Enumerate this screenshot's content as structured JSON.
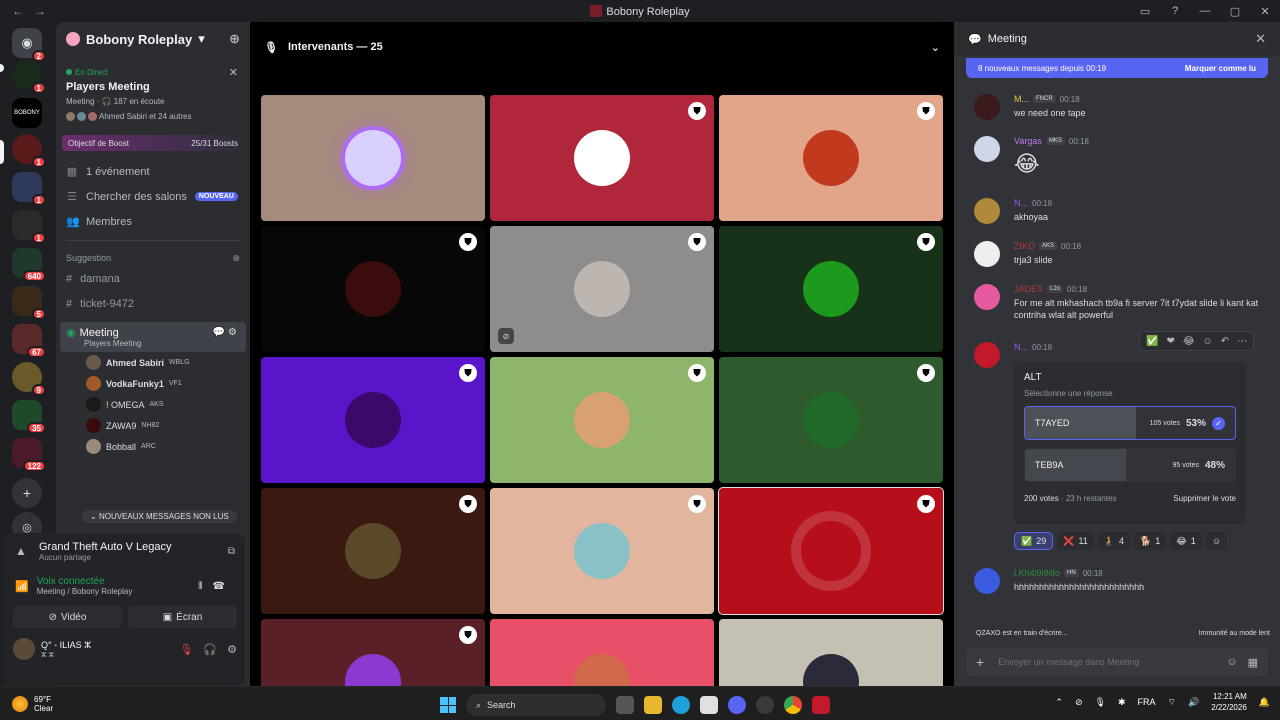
{
  "window": {
    "title": "Bobony Roleplay"
  },
  "rail": {
    "badges": [
      "2",
      "1",
      "1",
      "1",
      "1",
      "640",
      "5",
      "67",
      "9",
      "35",
      "122"
    ]
  },
  "server": {
    "name": "Bobony Roleplay"
  },
  "event": {
    "live_label": "En Direct",
    "title": "Players Meeting",
    "meta_channel": "Meeting",
    "meta_listeners": "187 en écoute",
    "people": "Ahmed Sabiri et 24 autres"
  },
  "boost": {
    "label": "Objectif de Boost",
    "progress": "25/31 Boosts"
  },
  "nav": {
    "events": "1 événement",
    "browse": "Chercher des salons",
    "browse_badge": "NOUVEAU",
    "members": "Membres"
  },
  "category": {
    "name": "Suggestion"
  },
  "channels": [
    "damana",
    "ticket-9472"
  ],
  "voice_channel": {
    "name": "Meeting",
    "sub": "Players Meeting"
  },
  "voice_users": [
    {
      "name": "Ahmed Sabiri",
      "tag": "WBLG"
    },
    {
      "name": "VodkaFunky1",
      "tag": "VF1"
    },
    {
      "name": "! OMEGA",
      "tag": "AKS"
    },
    {
      "name": "ZAWA9",
      "tag": "NH82"
    },
    {
      "name": "Bobball",
      "tag": "ARC"
    }
  ],
  "new_messages_pill": "NOUVEAUX MESSAGES NON LUS",
  "activity": {
    "game": "Grand Theft Auto V Legacy",
    "status": "Aucun partage"
  },
  "voice_status": {
    "title": "Voix connectée",
    "sub": "Meeting / Bobony Roleplay"
  },
  "buttons": {
    "video": "Vidéo",
    "screen": "Écran"
  },
  "user": {
    "name": "Q° - ILIAS ⵣ",
    "status": "ⵣ ⵣ"
  },
  "stage": {
    "header": "Intervenants — 25"
  },
  "chat": {
    "title": "Meeting",
    "unread_text": "8 nouveaux messages depuis 00:19",
    "mark_read": "Marquer comme lu",
    "messages": [
      {
        "name": "M...",
        "tag": "FNCR",
        "time": "00:18",
        "text": "we need one tape",
        "color": "#e8c547"
      },
      {
        "name": "Vargas",
        "tag": "MKS",
        "time": "00:18",
        "text": "😂",
        "color": "#c27cf2"
      },
      {
        "name": "N...",
        "tag": "",
        "time": "00:18",
        "text": "akhoyaa",
        "color": "#8d5ae0"
      },
      {
        "name": "ZIKO",
        "tag": "AKS",
        "time": "00:18",
        "text": "trja3 slide",
        "color": "#b83a3a"
      },
      {
        "name": "JADEX",
        "tag": "L2o",
        "time": "00:18",
        "text": "For me alt mkhashach tb9a fi server 7it t7ydat slide li kant kat contriha wlat alt powerful",
        "color": "#b83a3a"
      },
      {
        "name": "N...",
        "tag": "",
        "time": "00:18",
        "text": "",
        "color": "#8d5ae0"
      },
      {
        "name": "l.Kh4i9i9ilfo",
        "tag": "HN",
        "time": "00:18",
        "text": "hhhhhhhhhhhhhhhhhhhhhhhhhh",
        "color": "#2e8b3a"
      }
    ],
    "poll": {
      "question": "ALT",
      "select_hint": "Sélectionne une réponse",
      "options": [
        {
          "label": "T7AYED",
          "votes": "105 votes",
          "pct": "53%",
          "fraction": 0.53,
          "chosen": true
        },
        {
          "label": "TEB9A",
          "votes": "95 votes",
          "pct": "48%",
          "fraction": 0.48,
          "chosen": false
        }
      ],
      "total": "200 votes",
      "remaining": "23 h restantes",
      "remove": "Supprimer le vote"
    },
    "reactions": [
      {
        "emoji": "✅",
        "count": "29",
        "me": true
      },
      {
        "emoji": "❌",
        "count": "11",
        "me": false
      },
      {
        "emoji": "🧎",
        "count": "4",
        "me": false
      },
      {
        "emoji": "🐕",
        "count": "1",
        "me": false
      },
      {
        "emoji": "😂",
        "count": "1",
        "me": false
      }
    ],
    "typing": "QZAXO est en train d'écrire...",
    "slowmode": "Immunité au mode lent",
    "placeholder": "Envoyer un message dans Meeting"
  },
  "taskbar": {
    "temp": "69°F",
    "condition": "Clear",
    "search": "Search",
    "lang": "FRA",
    "time": "12:21 AM",
    "date": "2/22/2026"
  },
  "tiles": [
    {
      "bg": "#a58a7e",
      "av": "#d9d0ff",
      "mod": false
    },
    {
      "bg": "#b0263a",
      "av": "#ffffff",
      "mod": true
    },
    {
      "bg": "#e2a58a",
      "av": "#c23a1e",
      "mod": true
    },
    {
      "bg": "#070707",
      "av": "#3a0d0d",
      "mod": true
    },
    {
      "bg": "#8f8c8c",
      "av": "#bcb5b0",
      "mod": true,
      "hidden": true
    },
    {
      "bg": "#173218",
      "av": "#1c9a1e",
      "mod": true
    },
    {
      "bg": "#5a14c9",
      "av": "#3a0a6a",
      "mod": true
    },
    {
      "bg": "#8db66c",
      "av": "#d9a070",
      "mod": true
    },
    {
      "bg": "#2e5a2e",
      "av": "#1f6a2a",
      "mod": true
    },
    {
      "bg": "#3a1a10",
      "av": "#5a4a2a",
      "mod": true
    },
    {
      "bg": "#e1b59e",
      "av": "#8ac1c6",
      "mod": true
    },
    {
      "bg": "#b60f1a",
      "av": "#c83a40",
      "mod": true
    },
    {
      "bg": "#5a2028",
      "av": "#8a3ad0",
      "mod": true
    },
    {
      "bg": "#e85068",
      "av": "#d06a4a",
      "mod": false
    },
    {
      "bg": "#c5c1b2",
      "av": "#2a2a3a",
      "mod": false
    }
  ]
}
